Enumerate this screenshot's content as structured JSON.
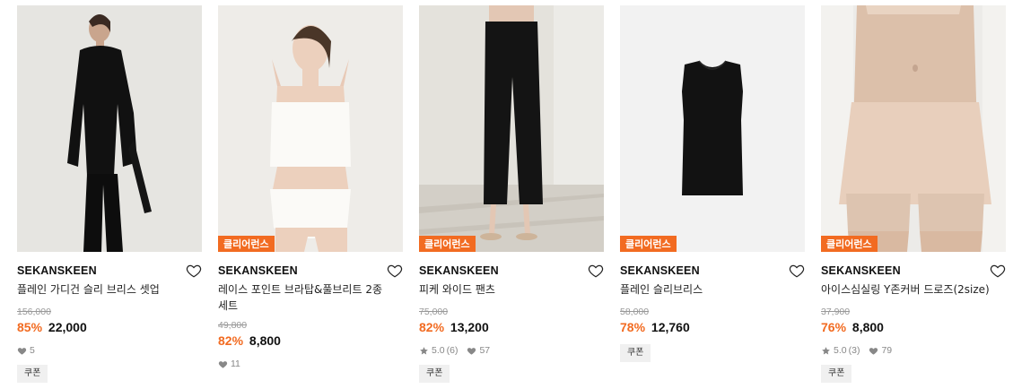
{
  "products": [
    {
      "brand": "SEKANSKEEN",
      "name": "플레인 가디건 슬리 브리스 셋업",
      "original_price": "156,000",
      "discount_rate": "85%",
      "sale_price": "22,000",
      "rating": "",
      "reviews": "",
      "likes": "5",
      "badge": "",
      "coupon": "쿠폰"
    },
    {
      "brand": "SEKANSKEEN",
      "name": "레이스 포인트 브라탑&풀브리트 2종 세트",
      "original_price": "49,800",
      "discount_rate": "82%",
      "sale_price": "8,800",
      "rating": "",
      "reviews": "",
      "likes": "11",
      "badge": "클리어런스",
      "coupon": ""
    },
    {
      "brand": "SEKANSKEEN",
      "name": "피케 와이드 팬츠",
      "original_price": "75,000",
      "discount_rate": "82%",
      "sale_price": "13,200",
      "rating": "5.0",
      "reviews": "(6)",
      "likes": "57",
      "badge": "클리어런스",
      "coupon": "쿠폰"
    },
    {
      "brand": "SEKANSKEEN",
      "name": "플레인 슬리브리스",
      "original_price": "58,000",
      "discount_rate": "78%",
      "sale_price": "12,760",
      "rating": "",
      "reviews": "",
      "likes": "",
      "badge": "클리어런스",
      "coupon": "쿠폰"
    },
    {
      "brand": "SEKANSKEEN",
      "name": "아이스심실링 Y존커버 드로즈(2size)",
      "original_price": "37,900",
      "discount_rate": "76%",
      "sale_price": "8,800",
      "rating": "5.0",
      "reviews": "(3)",
      "likes": "79",
      "badge": "클리어런스",
      "coupon": "쿠폰"
    }
  ],
  "colors": {
    "accent": "#f26b21",
    "muted": "#999999",
    "coupon_bg": "#f0f0f0"
  },
  "icons": {
    "wishlist": "heart-outline-icon",
    "likes": "heart-filled-icon",
    "rating": "star-icon"
  }
}
